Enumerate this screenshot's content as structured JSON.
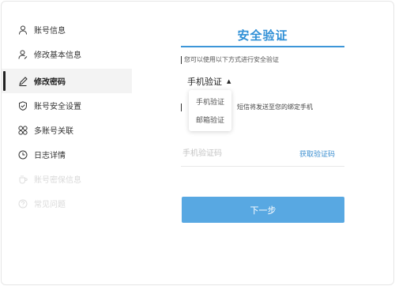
{
  "sidebar": {
    "items": [
      {
        "label": "账号信息",
        "icon": "user-icon"
      },
      {
        "label": "修改基本信息",
        "icon": "user-edit-icon"
      },
      {
        "label": "修改密码",
        "icon": "pencil-icon",
        "active": true
      },
      {
        "label": "账号安全设置",
        "icon": "shield-check-icon"
      },
      {
        "label": "多账号关联",
        "icon": "grid-link-icon"
      },
      {
        "label": "日志详情",
        "icon": "clock-icon"
      },
      {
        "label": "账号密保信息",
        "icon": "cup-icon",
        "disabled": true
      },
      {
        "label": "常见问题",
        "icon": "question-icon",
        "disabled": true
      }
    ]
  },
  "main": {
    "title": "安全验证",
    "hint": "您可以使用以下方式进行安全验证",
    "method_selected": "手机验证",
    "method_options": [
      "手机验证",
      "邮箱验证"
    ],
    "sms_note": "短信将发送至您的绑定手机",
    "code_placeholder": "手机验证码",
    "get_code_label": "获取验证码",
    "next_label": "下一步"
  },
  "colors": {
    "accent": "#2f8fd6",
    "button": "#58a8e2",
    "disabled_text": "#d9d9d9"
  }
}
